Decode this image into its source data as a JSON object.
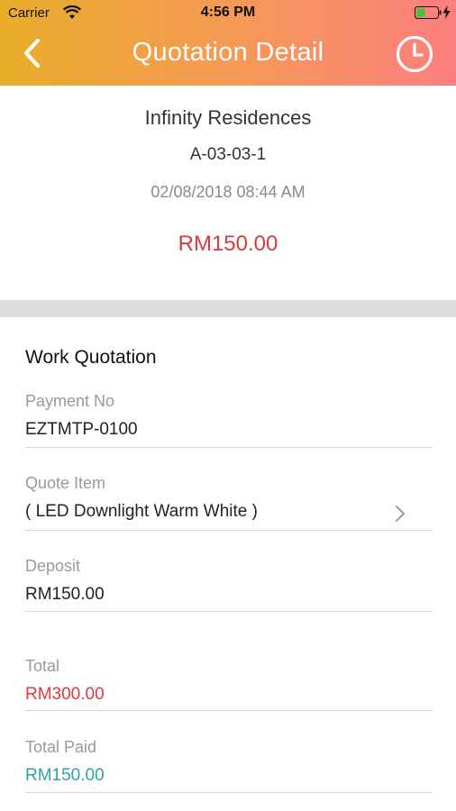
{
  "status_bar": {
    "carrier": "Carrier",
    "time": "4:56 PM"
  },
  "header": {
    "title": "Quotation Detail",
    "back_icon": "chevron-left-icon",
    "history_icon": "clock-icon"
  },
  "summary": {
    "property": "Infinity Residences",
    "unit": "A-03-03-1",
    "datetime": "02/08/2018 08:44 AM",
    "amount": "RM150.00"
  },
  "section": {
    "title": "Work Quotation",
    "fields": {
      "payment_no": {
        "label": "Payment No",
        "value": "EZTMTP-0100"
      },
      "quote_item": {
        "label": "Quote Item",
        "value": "( LED Downlight Warm White  )"
      },
      "deposit": {
        "label": "Deposit",
        "value": "RM150.00"
      },
      "total": {
        "label": "Total",
        "value": "RM300.00"
      },
      "total_paid": {
        "label": "Total Paid",
        "value": "RM150.00"
      }
    }
  },
  "colors": {
    "accent_red": "#e0383e",
    "teal": "#2ea3a8",
    "header_start": "#e9ad2a",
    "header_end": "#fb7f7f"
  }
}
